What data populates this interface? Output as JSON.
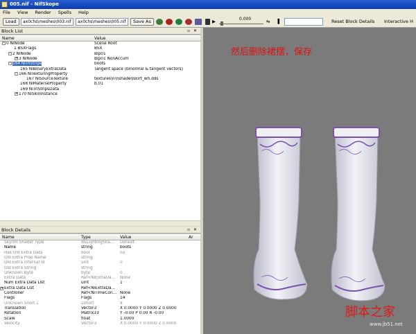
{
  "window": {
    "title": "005.nif - NifSkope"
  },
  "menu": [
    "File",
    "View",
    "Render",
    "Spells",
    "Help"
  ],
  "toolbar": {
    "load_label": "Load",
    "load_path": "ax0chs\\meshes\\003.nif",
    "save_path": "ax0chs\\meshes\\005.nif",
    "save_label": "Save As",
    "slider_value": "0.000",
    "reset_label": "Reset Block Details",
    "interactive_label": "Interactive H"
  },
  "block_list": {
    "title": "Block List",
    "columns": [
      "Name",
      "Value"
    ],
    "rows": [
      {
        "name": "0 NiNode",
        "value": "Scene Root",
        "indent": 0,
        "exp": "-"
      },
      {
        "name": "1 BSXFlags",
        "value": "BSX",
        "indent": 1,
        "exp": ""
      },
      {
        "name": "2 NiNode",
        "value": "Bip01",
        "indent": 1,
        "exp": "-"
      },
      {
        "name": "3 NiNode",
        "value": "Bip01 NonAccum",
        "indent": 2,
        "exp": "+"
      },
      {
        "name": "164 NiTriStrips",
        "value": "boots",
        "indent": 1,
        "exp": "-",
        "selected": true
      },
      {
        "name": "165 NiBinaryExtraData",
        "value": "Tangent space (binormal & tangent vectors)",
        "indent": 2,
        "exp": ""
      },
      {
        "name": "166 NiTexturingProperty",
        "value": "",
        "indent": 2,
        "exp": "-"
      },
      {
        "name": "167 NiSourceTexture",
        "value": "textures\\n\\nshade\\lskirt_wh.dds",
        "indent": 3,
        "exp": ""
      },
      {
        "name": "168 NiMaterialProperty",
        "value": "b.01",
        "indent": 2,
        "exp": ""
      },
      {
        "name": "169 NiTriStripsData",
        "value": "",
        "indent": 2,
        "exp": ""
      },
      {
        "name": "170 NiSkinInstance",
        "value": "",
        "indent": 2,
        "exp": "+"
      }
    ]
  },
  "block_details": {
    "title": "Block Details",
    "columns": [
      "Name",
      "Type",
      "Value",
      "Ar"
    ],
    "rows": [
      {
        "name": "Skyrim Shader Type",
        "type": "BSLightingSha...",
        "value": "Default",
        "dim": true
      },
      {
        "name": "Name",
        "type": "string",
        "value": "boots",
        "dim": false
      },
      {
        "name": "Has Old Extra Data",
        "type": "bool",
        "value": "no",
        "dim": true
      },
      {
        "name": "Old Extra Prop Name",
        "type": "string",
        "value": "",
        "dim": true
      },
      {
        "name": "Old Extra Internal Id",
        "type": "uint",
        "value": "0",
        "dim": true
      },
      {
        "name": "Old Extra String",
        "type": "string",
        "value": "",
        "dim": true
      },
      {
        "name": "Unknown Byte",
        "type": "byte",
        "value": "0",
        "dim": true
      },
      {
        "name": "Extra Data",
        "type": "Ref<NiExtraDa...",
        "value": "None",
        "dim": true
      },
      {
        "name": "Num Extra Data List",
        "type": "uint",
        "value": "1",
        "dim": false
      },
      {
        "name": "Extra Data List",
        "type": "Ref<NiExtraDa...",
        "value": "",
        "dim": false,
        "exp": "+"
      },
      {
        "name": "Controller",
        "type": "Ref<NiTimeCon...",
        "value": "None",
        "dim": false
      },
      {
        "name": "Flags",
        "type": "Flags",
        "value": "14",
        "dim": false
      },
      {
        "name": "Unknown Short 1",
        "type": "ushort",
        "value": "8",
        "dim": true
      },
      {
        "name": "Translation",
        "type": "Vector3",
        "value": "X 0.0000 Y 0.0000 Z 0.0000",
        "dim": false
      },
      {
        "name": "Rotation",
        "type": "Matrix33",
        "value": "Y -0.00 P 0.00 R -0.00",
        "dim": false
      },
      {
        "name": "Scale",
        "type": "float",
        "value": "1.0000",
        "dim": false
      },
      {
        "name": "Velocity",
        "type": "Vector3",
        "value": "X 0.0000 Y 0.0000 Z 0.0000",
        "dim": true
      }
    ]
  },
  "viewport": {
    "annotation": "然后删除裙摆，保存",
    "watermark": "脚本之家",
    "watermark_url": "www.jb51.net"
  },
  "colors": {
    "title_bar": "#0a3bb0",
    "selection": "#316ac5",
    "annotation": "#e01010",
    "viewport_bg": "#7b7b7b",
    "boot_trim": "#7a4fb0"
  }
}
